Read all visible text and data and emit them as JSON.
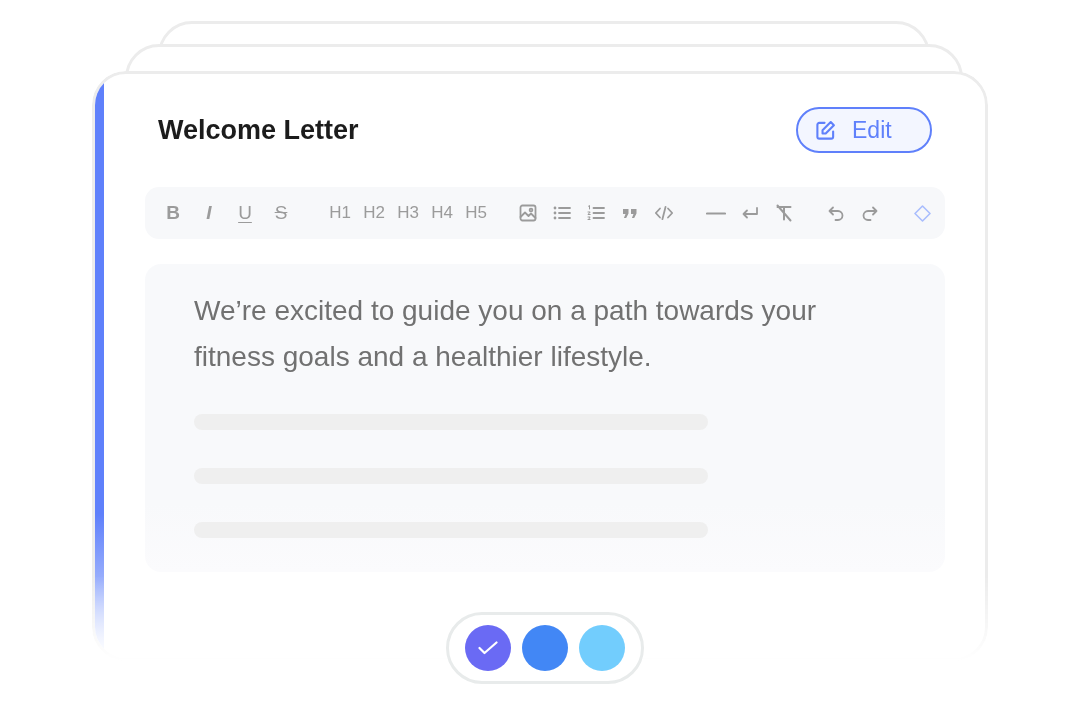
{
  "document": {
    "title": "Welcome Letter",
    "edit_button": {
      "label": "Edit"
    },
    "toolbar": {
      "format_buttons": [
        {
          "label": "B",
          "kind": "bold"
        },
        {
          "label": "I",
          "kind": "italic"
        },
        {
          "label": "U",
          "kind": "underline"
        },
        {
          "label": "S",
          "kind": "strikethrough"
        }
      ],
      "heading_buttons": [
        "H1",
        "H2",
        "H3",
        "H4",
        "H5"
      ]
    },
    "editor": {
      "text": "We’re excited to guide you on a path towards your fitness goals and a healthier lifestyle."
    }
  },
  "color_options": [
    {
      "color": "#6a6af4",
      "selected": true
    },
    {
      "color": "#4287f5",
      "selected": false
    },
    {
      "color": "#72cdfd",
      "selected": false
    }
  ]
}
